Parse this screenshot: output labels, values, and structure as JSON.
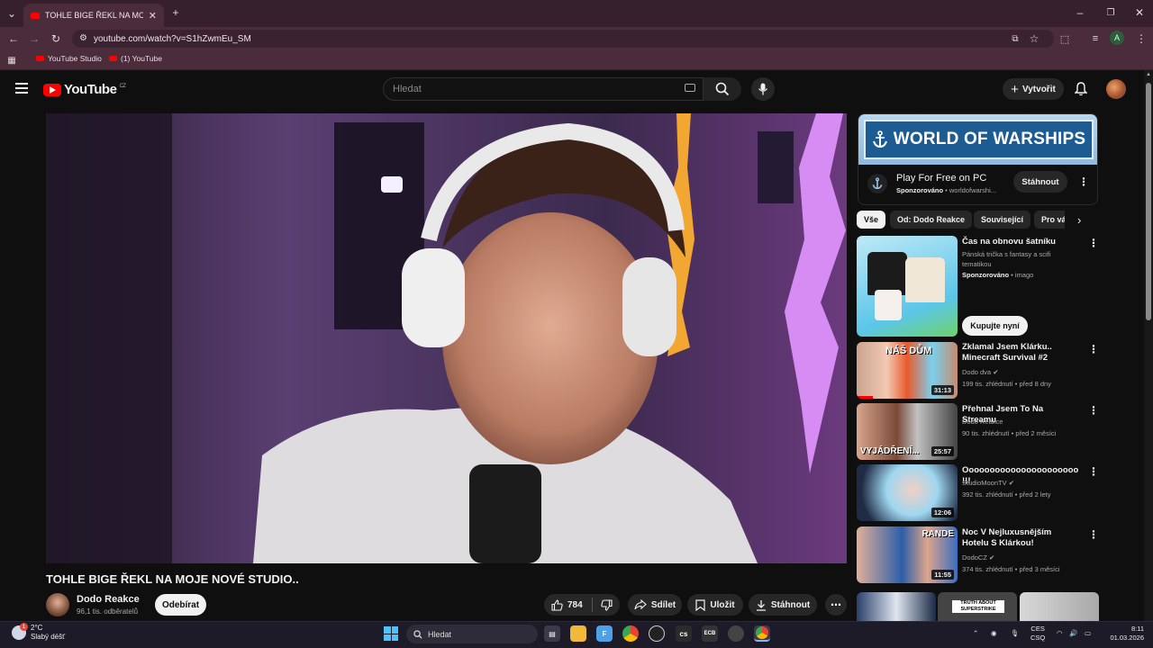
{
  "browser": {
    "tab_title": "TOHLE BIGE ŘEKL NA MOJE NOVÉ STUDIO..",
    "tab_title_display": "TOHLE BIGE ŘEKL NA MOJE NO",
    "url": "youtube.com/watch?v=S1hZwmEu_SM",
    "bookmarks": [
      {
        "label": "YouTube Studio"
      },
      {
        "label": "(1) YouTube"
      }
    ],
    "profile_initial": "A"
  },
  "header": {
    "logo_text": "YouTube",
    "region": "CZ",
    "search_placeholder": "Hledat",
    "create_label": "Vytvořit"
  },
  "video": {
    "title": "TOHLE BIGE ŘEKL NA MOJE NOVÉ STUDIO..",
    "channel": "Dodo Reakce",
    "subscribers": "96,1 tis. odběratelů",
    "subscribe_label": "Odebírat",
    "likes": "784",
    "share_label": "Sdílet",
    "save_label": "Uložit",
    "download_label": "Stáhnout"
  },
  "ad": {
    "banner_text": "WORLD OF WARSHIPS",
    "title": "Play For Free on PC",
    "sponsored": "Sponzorováno",
    "domain": " • worldofwarshi...",
    "button": "Stáhnout"
  },
  "chips": [
    "Vše",
    "Od: Dodo Reakce",
    "Související",
    "Pro vás"
  ],
  "sponsored_item": {
    "title": "Čas na obnovu šatníku",
    "desc_line1": "Pánská trička s fantasy a scifi",
    "desc_line2": "tematikou",
    "sponsored": "Sponzorováno",
    "source": " • imago",
    "button": "Kupujte nyní"
  },
  "recommendations": [
    {
      "title": "Zklamal Jsem Klárku.. Minecraft Survival #2",
      "channel": "Dodo dva",
      "meta": "199 tis. zhlédnutí • před 8 dny",
      "duration": "31:13",
      "thumb_text": "NÁŠ DŮM"
    },
    {
      "title": "Přehnal Jsem To Na Streamu",
      "channel": "Dodo Reakce",
      "meta": "90 tis. zhlédnutí • před 2 měsíci",
      "duration": "25:57",
      "thumb_text": "VYJÁDŘENÍ..."
    },
    {
      "title": "Oooooooooooooooooooooo !!!",
      "channel": "StudioMoonTV",
      "meta": "392 tis. zhlédnutí • před 2 lety",
      "duration": "12:06",
      "thumb_text": ""
    },
    {
      "title": "Noc V Nejluxusnějším Hotelu S Klárkou!",
      "channel": "DodoCZ",
      "meta": "374 tis. zhlédnutí • před 3 měsíci",
      "duration": "11:55",
      "thumb_text": "RANDE"
    }
  ],
  "partial_thumb_text": "TRUTH ABOUT SUPERSTRIKE",
  "taskbar": {
    "temp": "2°C",
    "weather": "Slabý déšť",
    "search": "Hledat",
    "lang1": "CES",
    "lang2": "CSQ",
    "time": "8:11",
    "date": "01.03.2026",
    "weather_badge": "1"
  },
  "colors": {
    "accent": "#ff0000",
    "browser_chrome": "#4a2c3b",
    "bg": "#0f0f0f"
  }
}
